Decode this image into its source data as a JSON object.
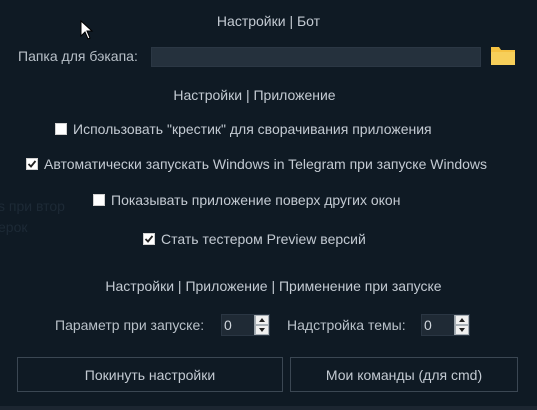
{
  "background_ghost": {
    "line1": "s при втор",
    "line2": "ерок"
  },
  "bot_section": {
    "title": "Настройки | Бот",
    "backup_folder_label": "Папка для бэкапа:",
    "backup_folder_value": "",
    "folder_icon": "folder-icon"
  },
  "app_section": {
    "title": "Настройки | Приложение",
    "options": [
      {
        "label": "Использовать \"крестик\" для сворачивания приложения",
        "checked": false
      },
      {
        "label": "Автоматически запускать Windows in Telegram при запуске Windows",
        "checked": true
      },
      {
        "label": "Показывать приложение поверх других окон",
        "checked": false
      },
      {
        "label": "Стать тестером Preview версий",
        "checked": true
      }
    ]
  },
  "startup_section": {
    "title": "Настройки | Приложение | Применение при запуске",
    "launch_param_label": "Параметр при запуске:",
    "launch_param_value": "0",
    "theme_label": "Надстройка темы:",
    "theme_value": "0"
  },
  "buttons": {
    "exit_settings": "Покинуть настройки",
    "my_commands": "Мои команды (для cmd)"
  },
  "colors": {
    "background": "#0f1a24",
    "text": "#c3cad2",
    "folder": "#f5c242"
  }
}
